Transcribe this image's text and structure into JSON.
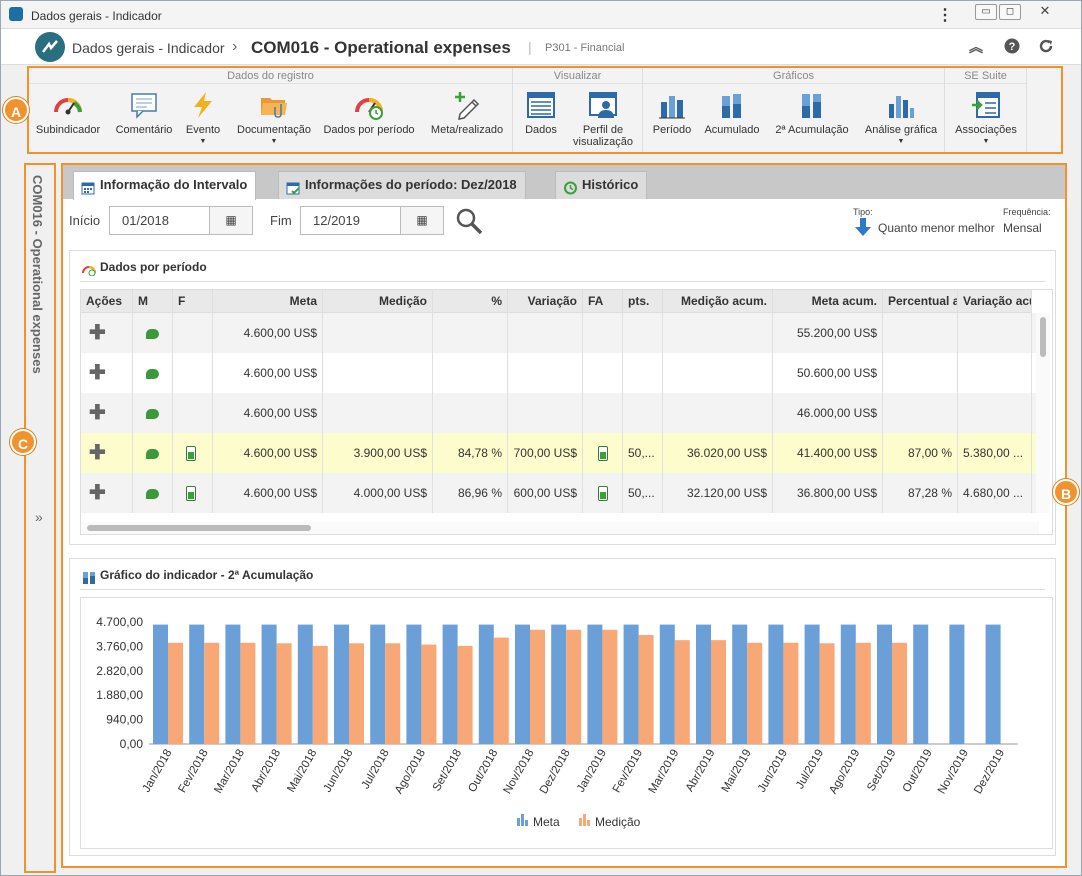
{
  "window": {
    "title": "Dados gerais - Indicador"
  },
  "header": {
    "logo_text": "",
    "breadcrumb": "Dados gerais - Indicador",
    "separator": "›",
    "title": "COM016 - Operational expenses",
    "divider": "|",
    "subtitle": "P301 - Financial"
  },
  "ribbon": {
    "groups": [
      {
        "title": "Dados do registro",
        "buttons": [
          "Subindicador",
          "Comentário",
          "Evento",
          "Documentação",
          "Dados por período",
          "Meta/realizado"
        ]
      },
      {
        "title": "Visualizar",
        "buttons": [
          "Dados",
          "Perfil de",
          "visualização"
        ]
      },
      {
        "title": "Gráficos",
        "buttons": [
          "Período",
          "Acumulado",
          "2ª Acumulação",
          "Análise gráfica"
        ]
      },
      {
        "title": "SE Suite",
        "buttons": [
          "Associações"
        ]
      }
    ]
  },
  "badges": {
    "a": "A",
    "b": "B",
    "c": "C"
  },
  "sidebar": {
    "label": "COM016 - Operational expenses",
    "expand": "»"
  },
  "tabs": [
    "Informação do Intervalo",
    "Informações do período: Dez/2018",
    "Histórico"
  ],
  "filters": {
    "start_label": "Início",
    "start_value": "01/2018",
    "end_label": "Fim",
    "end_value": "12/2019",
    "type_label": "Tipo:",
    "type_value": "Quanto menor melhor",
    "freq_label": "Frequência:",
    "freq_value": "Mensal"
  },
  "period_panel": {
    "title": "Dados por período",
    "columns": [
      "Ações",
      "M",
      "F",
      "Meta",
      "Medição",
      "%",
      "Variação",
      "FA",
      "pts.",
      "Medição acum.",
      "Meta acum.",
      "Percentual a",
      "Variação acu"
    ],
    "rows": [
      {
        "meta": "4.600,00 US$",
        "medicao": "",
        "pct": "",
        "variacao": "",
        "fa": false,
        "pts": "",
        "med_acum": "",
        "meta_acum": "55.200,00 US$",
        "perc_acum": "",
        "var_acum": "",
        "f": false
      },
      {
        "meta": "4.600,00 US$",
        "medicao": "",
        "pct": "",
        "variacao": "",
        "fa": false,
        "pts": "",
        "med_acum": "",
        "meta_acum": "50.600,00 US$",
        "perc_acum": "",
        "var_acum": "",
        "f": false
      },
      {
        "meta": "4.600,00 US$",
        "medicao": "",
        "pct": "",
        "variacao": "",
        "fa": false,
        "pts": "",
        "med_acum": "",
        "meta_acum": "46.000,00 US$",
        "perc_acum": "",
        "var_acum": "",
        "f": false
      },
      {
        "meta": "4.600,00 US$",
        "medicao": "3.900,00 US$",
        "pct": "84,78 %",
        "variacao": "700,00 US$",
        "fa": true,
        "pts": "50,...",
        "med_acum": "36.020,00 US$",
        "meta_acum": "41.400,00 US$",
        "perc_acum": "87,00 %",
        "var_acum": "5.380,00 ...",
        "f": true,
        "highlight": true
      },
      {
        "meta": "4.600,00 US$",
        "medicao": "4.000,00 US$",
        "pct": "86,96 %",
        "variacao": "600,00 US$",
        "fa": true,
        "pts": "50,...",
        "med_acum": "32.120,00 US$",
        "meta_acum": "36.800,00 US$",
        "perc_acum": "87,28 %",
        "var_acum": "4.680,00 ...",
        "f": true
      }
    ]
  },
  "chart_panel": {
    "title": "Gráfico do indicador - 2ª Acumulação"
  },
  "chart_data": {
    "type": "bar",
    "categories": [
      "Jan/2018",
      "Fev/2018",
      "Mar/2018",
      "Abr/2018",
      "Mai/2018",
      "Jun/2018",
      "Jul/2018",
      "Ago/2018",
      "Set/2018",
      "Out/2018",
      "Nov/2018",
      "Dez/2018",
      "Jan/2019",
      "Fev/2019",
      "Mar/2019",
      "Abr/2019",
      "Mai/2019",
      "Jun/2019",
      "Jul/2019",
      "Ago/2019",
      "Set/2019",
      "Out/2019",
      "Nov/2019",
      "Dez/2019"
    ],
    "series": [
      {
        "name": "Meta",
        "color": "#6a9fd8",
        "values": [
          4600,
          4600,
          4600,
          4600,
          4600,
          4600,
          4600,
          4600,
          4600,
          4600,
          4600,
          4600,
          4600,
          4600,
          4600,
          4600,
          4600,
          4600,
          4600,
          4600,
          4600,
          4600,
          4600,
          4600
        ]
      },
      {
        "name": "Medição",
        "color": "#f8a877",
        "values": [
          3900,
          3900,
          3900,
          3880,
          3780,
          3880,
          3880,
          3830,
          3780,
          4100,
          4400,
          4400,
          4400,
          4200,
          4000,
          4000,
          3900,
          3900,
          3880,
          3900,
          3900,
          null,
          null,
          null
        ]
      }
    ],
    "yticks": [
      "4.700,00",
      "3.760,00",
      "2.820,00",
      "1.880,00",
      "940,00",
      "0,00"
    ],
    "ylim": [
      0,
      4700
    ],
    "legend": "bottom"
  }
}
